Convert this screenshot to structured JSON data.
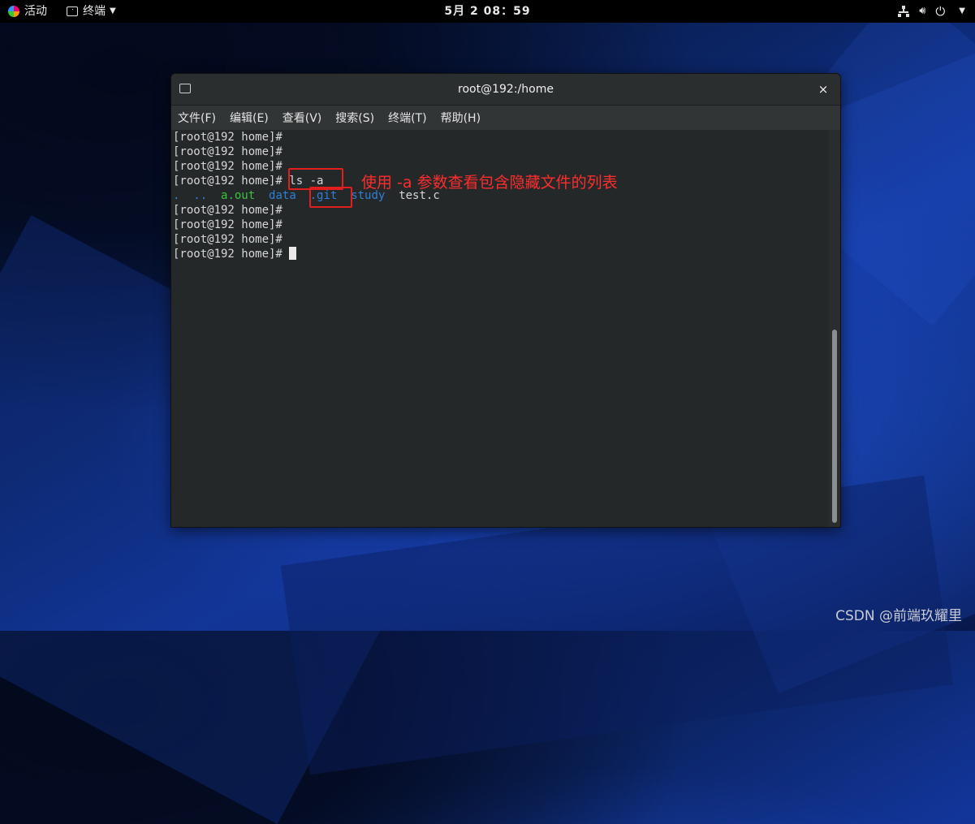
{
  "topbar": {
    "activities": "活动",
    "app_menu": "终端",
    "clock": "5月 2  08：59",
    "tray_icons": [
      "network-icon",
      "volume-icon",
      "power-icon"
    ]
  },
  "window": {
    "title": "root@192:/home",
    "close_glyph": "×",
    "menu": [
      "文件(F)",
      "编辑(E)",
      "查看(V)",
      "搜索(S)",
      "终端(T)",
      "帮助(H)"
    ]
  },
  "terminal": {
    "prompt": "[root@192 home]#",
    "command": "ls -a",
    "listing": {
      "dot": ".",
      "dotdot": "..",
      "aout": "a.out",
      "data": "data",
      "git": ".git",
      "study": "study",
      "testc": "test.c"
    }
  },
  "annotation": "使用 -a 参数查看包含隐藏文件的列表",
  "watermark": "CSDN @前端玖耀里",
  "colors": {
    "annotation_red": "#e21e1e",
    "dir_blue": "#2f7fd6",
    "exec_green": "#3cc33c"
  }
}
